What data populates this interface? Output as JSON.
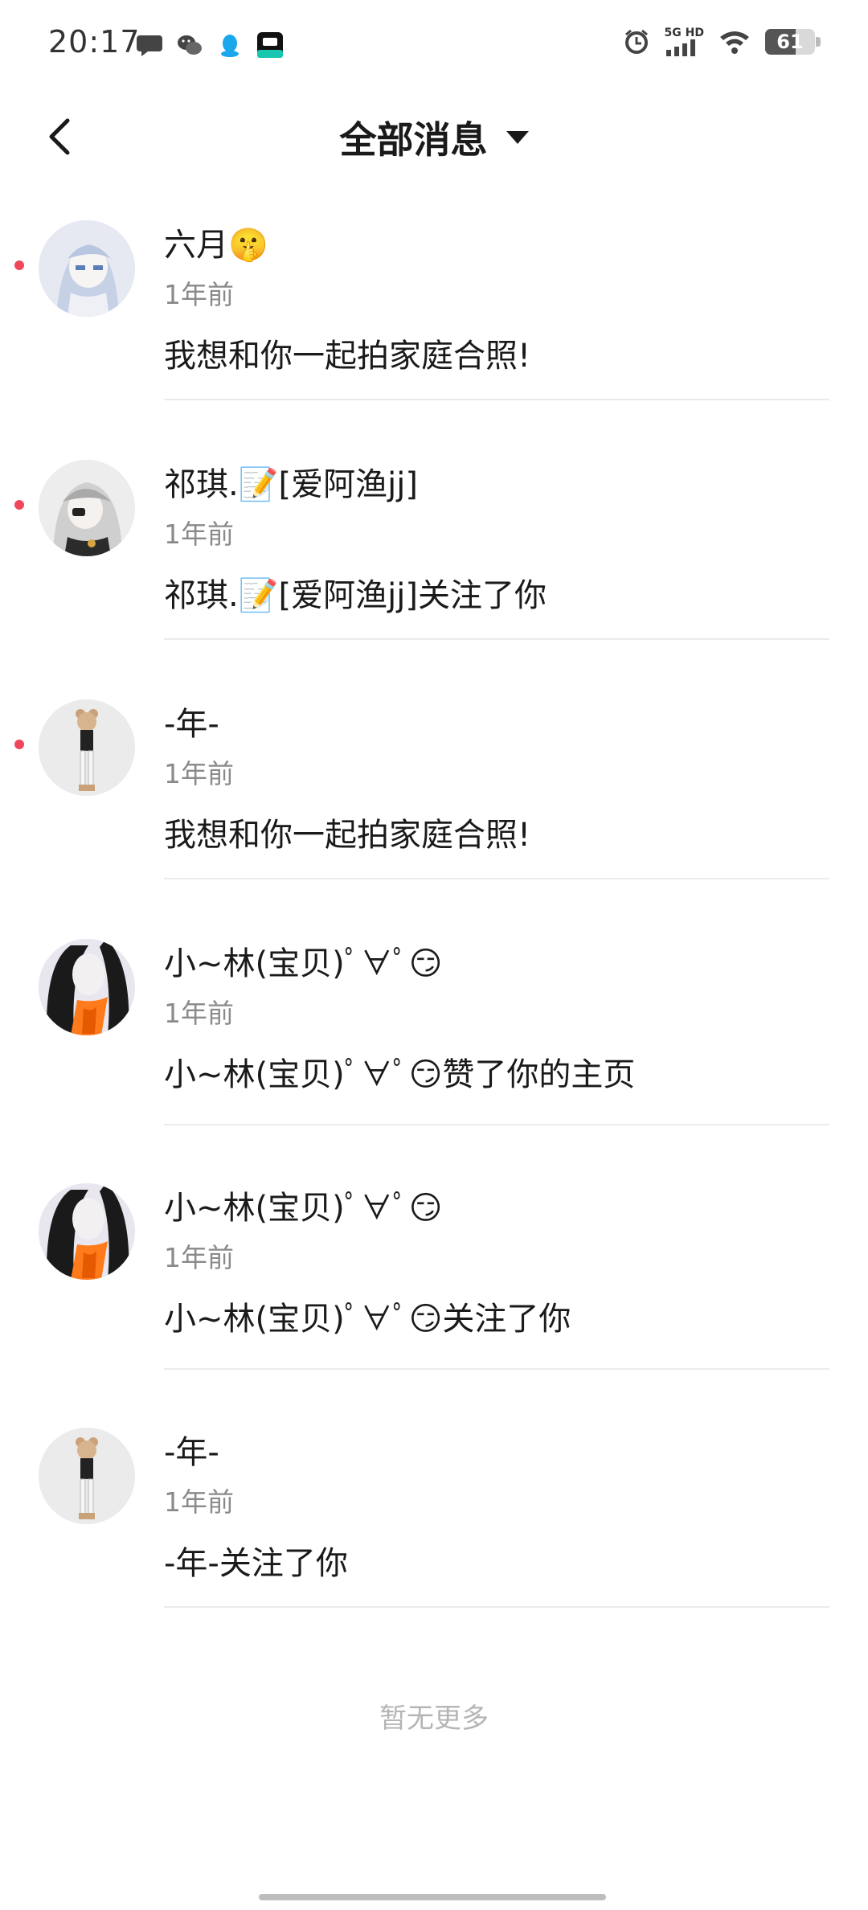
{
  "status": {
    "time": "20:17",
    "network": "5G HD",
    "battery": "61",
    "battery_level": 0.61,
    "left_icons": [
      "chat-bubble-icon",
      "wechat-icon",
      "qq-icon",
      "dewu-app-icon"
    ],
    "right_icons": [
      "alarm-icon",
      "signal-icon",
      "wifi-icon",
      "battery-icon"
    ]
  },
  "header": {
    "title": "全部消息",
    "back_icon": "chevron-left-icon",
    "dropdown_icon": "caret-down-icon"
  },
  "messages": [
    {
      "name": "六月🤫",
      "time": "1年前",
      "text": "我想和你一起拍家庭合照!",
      "unread": true,
      "avatar": "anime-girl-white-hair-avatar"
    },
    {
      "name": "祁琪.📝[爱阿渔jj]",
      "time": "1年前",
      "text": "祁琪.📝[爱阿渔jj]关注了你",
      "unread": true,
      "avatar": "anime-girl-gray-hair-avatar"
    },
    {
      "name": "-年-",
      "time": "1年前",
      "text": "我想和你一起拍家庭合照!",
      "unread": true,
      "avatar": "bear-figure-avatar"
    },
    {
      "name": "小~林(宝贝)ﾟ∀ﾟ😏",
      "time": "1年前",
      "text": "小~林(宝贝)ﾟ∀ﾟ😏赞了你的主页",
      "unread": false,
      "avatar": "black-white-figure-orange-scarf-avatar"
    },
    {
      "name": "小~林(宝贝)ﾟ∀ﾟ😏",
      "time": "1年前",
      "text": "小~林(宝贝)ﾟ∀ﾟ😏关注了你",
      "unread": false,
      "avatar": "black-white-figure-orange-scarf-avatar"
    },
    {
      "name": "-年-",
      "time": "1年前",
      "text": "-年-关注了你",
      "unread": false,
      "avatar": "bear-figure-avatar"
    }
  ],
  "footer": {
    "no_more": "暂无更多"
  },
  "colors": {
    "unread_dot": "#f0465a",
    "divider": "#ebebeb",
    "secondary_text": "#8a8a8a",
    "no_more_text": "#b5b5b5"
  }
}
